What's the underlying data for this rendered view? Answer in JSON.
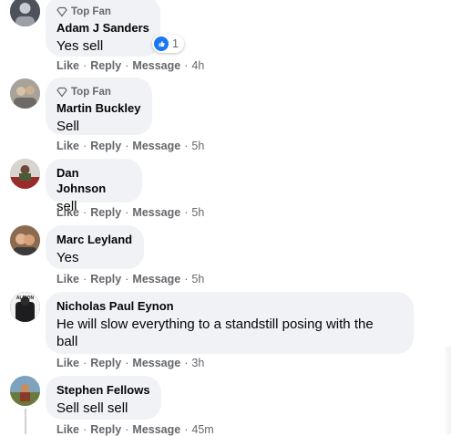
{
  "comments": [
    {
      "badge": "Top Fan",
      "author": "Adam J Sanders",
      "text": "Yes sell",
      "reaction_count": "1",
      "actions": {
        "like": "Like",
        "reply": "Reply",
        "message": "Message",
        "time": "4h"
      },
      "avatar_color": "#5a5f66"
    },
    {
      "badge": "Top Fan",
      "author": "Martin Buckley",
      "text": "Sell",
      "actions": {
        "like": "Like",
        "reply": "Reply",
        "message": "Message",
        "time": "5h"
      },
      "avatar_color": "#8a7a6c"
    },
    {
      "author": "Dan Johnson",
      "text": "sell",
      "actions": {
        "like": "Like",
        "reply": "Reply",
        "message": "Message",
        "time": "5h"
      },
      "avatar_color": "#6b4a3a"
    },
    {
      "author": "Marc Leyland",
      "text": "Yes",
      "actions": {
        "like": "Like",
        "reply": "Reply",
        "message": "Message",
        "time": "5h"
      },
      "avatar_color": "#7a5a44"
    },
    {
      "author": "Nicholas Paul Eynon",
      "text_line1": "He will slow everything to a standstill posing with the",
      "text_line2": "ball",
      "avatar_text": "ALBION",
      "actions": {
        "like": "Like",
        "reply": "Reply",
        "message": "Message",
        "time": "3h"
      },
      "avatar_color": "#1d1d1f"
    },
    {
      "author": "Stephen Fellows",
      "text": "Sell sell sell",
      "actions": {
        "like": "Like",
        "reply": "Reply",
        "message": "Message",
        "time": "45m"
      },
      "avatar_color": "#5e7a8e"
    }
  ],
  "separator": "·",
  "colors": {
    "bubble": "#f0f2f5",
    "meta": "#65676b",
    "like_blue": "#1877f2"
  }
}
